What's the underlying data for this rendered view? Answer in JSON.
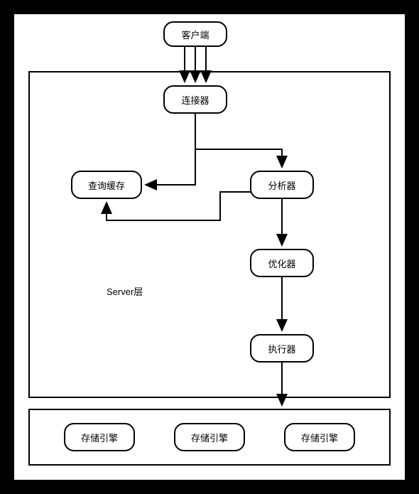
{
  "nodes": {
    "client": "客户端",
    "connector": "连接器",
    "cache": "查询缓存",
    "analyzer": "分析器",
    "optimizer": "优化器",
    "executor": "执行器",
    "engine1": "存储引擎",
    "engine2": "存储引擎",
    "engine3": "存储引擎"
  },
  "labels": {
    "server_layer": "Server层"
  }
}
